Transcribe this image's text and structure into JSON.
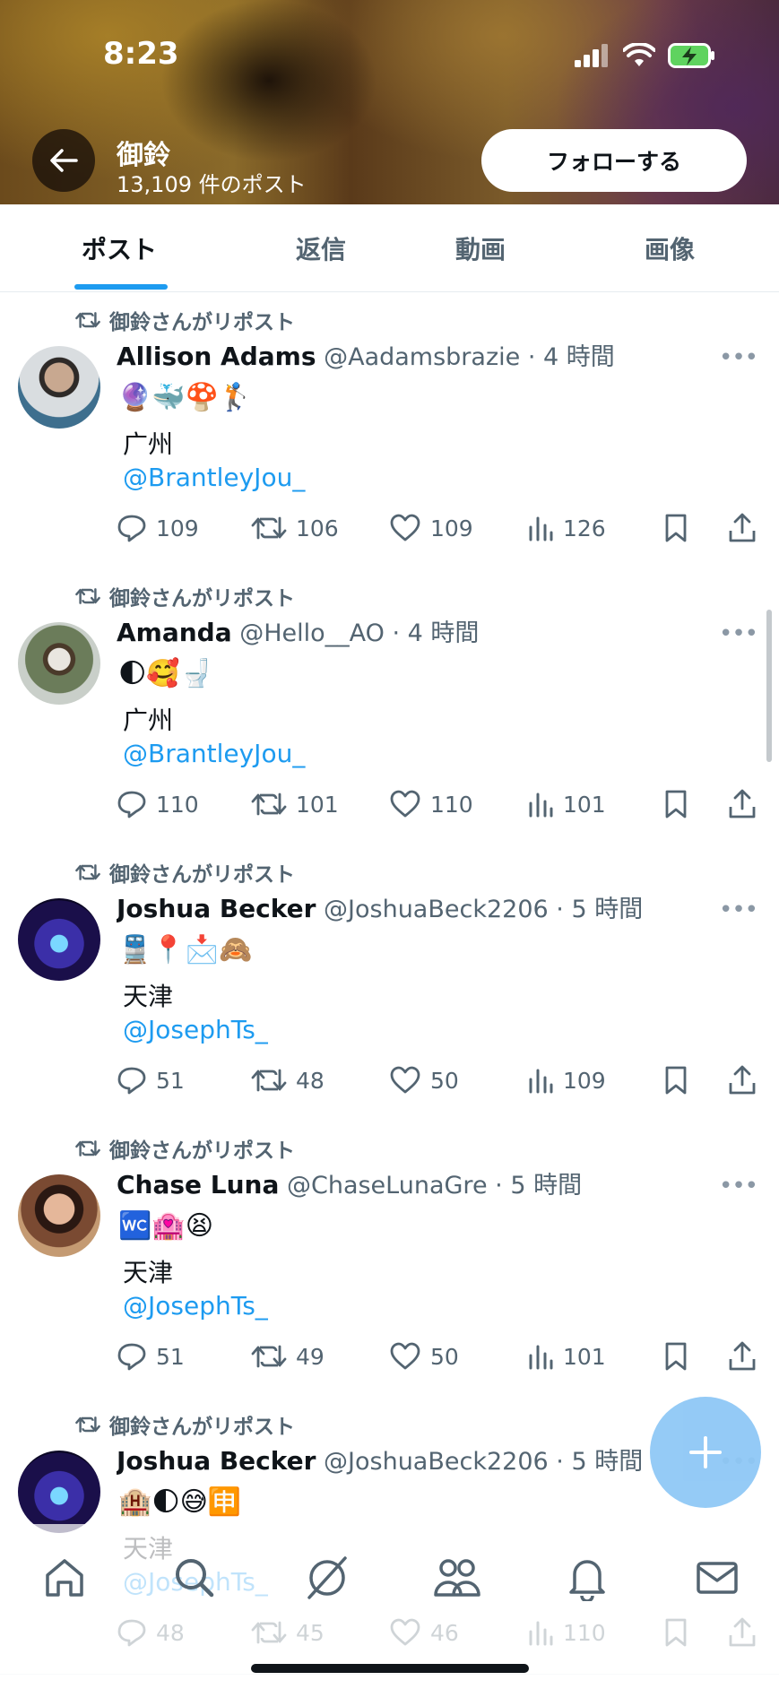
{
  "status_bar": {
    "time": "8:23"
  },
  "header": {
    "profile_name": "御鈴",
    "post_count": "13,109 件のポスト",
    "follow_label": "フォローする"
  },
  "tabs": [
    {
      "label": "ポスト",
      "active": true
    },
    {
      "label": "返信",
      "active": false
    },
    {
      "label": "動画",
      "active": false
    },
    {
      "label": "画像",
      "active": false
    }
  ],
  "posts": [
    {
      "repost_label": "御鈴さんがリポスト",
      "name": "Allison Adams",
      "handle": "@Aadamsbrazie",
      "time": "· 4 時間",
      "emojis": "🔮🐳🍄🏌",
      "city": "广州",
      "mention": "@BrantleyJou_",
      "replies": "109",
      "reposts": "106",
      "likes": "109",
      "views": "126"
    },
    {
      "repost_label": "御鈴さんがリポスト",
      "name": "Amanda",
      "handle": "@Hello__AO",
      "time": "· 4 時間",
      "emojis": "🌓🥰🚽",
      "city": "广州",
      "mention": "@BrantleyJou_",
      "replies": "110",
      "reposts": "101",
      "likes": "110",
      "views": "101"
    },
    {
      "repost_label": "御鈴さんがリポスト",
      "name": "Joshua Becker",
      "handle": "@JoshuaBeck2206",
      "time": "· 5 時間",
      "emojis": "🚆📍📩🙈",
      "city": "天津",
      "mention": "@JosephTs_",
      "replies": "51",
      "reposts": "48",
      "likes": "50",
      "views": "109"
    },
    {
      "repost_label": "御鈴さんがリポスト",
      "name": "Chase Luna",
      "handle": "@ChaseLunaGre",
      "time": "· 5 時間",
      "emojis": "🚾🏩😫",
      "city": "天津",
      "mention": "@JosephTs_",
      "replies": "51",
      "reposts": "49",
      "likes": "50",
      "views": "101"
    },
    {
      "repost_label": "御鈴さんがリポスト",
      "name": "Joshua Becker",
      "handle": "@JoshuaBeck2206",
      "time": "· 5 時間",
      "emojis": "🏨🌓😅🈸",
      "city": "天津",
      "mention": "@JosephTs_",
      "replies": "48",
      "reposts": "45",
      "likes": "46",
      "views": "110"
    }
  ],
  "fab": {
    "icon": "plus-icon"
  },
  "bottom_nav": [
    "home-icon",
    "search-icon",
    "grok-icon",
    "communities-icon",
    "notifications-icon",
    "messages-icon"
  ],
  "colors": {
    "accent": "#1d9bf0",
    "text": "#0f1419",
    "muted": "#536471"
  }
}
